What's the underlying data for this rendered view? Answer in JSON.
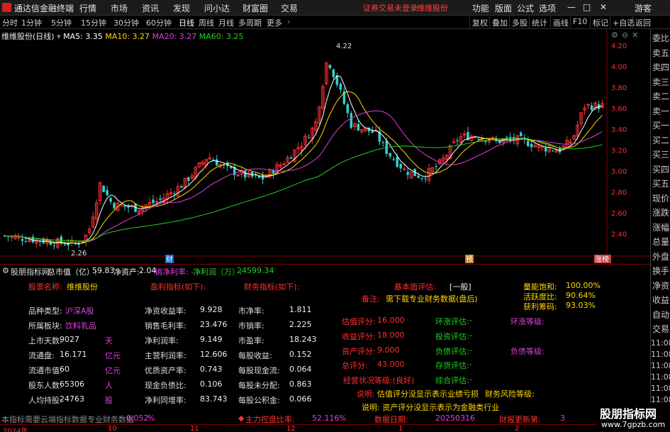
{
  "menubar": {
    "title": "通达信金融终端",
    "items": [
      "行情",
      "市场",
      "资讯",
      "发现",
      "问小达",
      "财富圈",
      "交易"
    ],
    "notice": "证券交易未登录",
    "notice2": "维维股份",
    "right_items": [
      "功能",
      "版面",
      "公式",
      "选项"
    ],
    "minimize": "—",
    "maximize": "□",
    "close": "✕",
    "guest": "游客"
  },
  "toolbar": {
    "periods": [
      "分时",
      "1分钟",
      "5分钟",
      "15分钟",
      "30分钟",
      "60分钟",
      "日线",
      "周线",
      "月线",
      "多周期",
      "更多"
    ],
    "active": "日线",
    "right_tools": [
      "复权",
      "叠加",
      "多股",
      "统计",
      "画线",
      "F10",
      "标记",
      "+自选",
      "返回"
    ]
  },
  "legend": {
    "name": "维维股份(日线)",
    "ma5": "MA5: 3.35",
    "ma10": "MA10: 3.27",
    "ma20": "MA20: 3.27",
    "ma60": "MA60: 3.25"
  },
  "colors": {
    "ma5": "#ffffff",
    "ma10": "#ffd700",
    "ma20": "#e040e0",
    "ma60": "#20d020",
    "up": "#ff3030",
    "down": "#30d0d0"
  },
  "price_axis": {
    "ticks": [
      "4.20",
      "4.00",
      "3.80",
      "3.60",
      "3.40",
      "3.20",
      "3.00",
      "2.80",
      "2.60",
      "2.40"
    ],
    "high_label": "4.22",
    "low_label": "2.26"
  },
  "chart_data": {
    "type": "candlestick",
    "x_labels": [
      "2024年",
      "10",
      "11",
      "12",
      "1",
      "2"
    ],
    "markers": [
      "财",
      "预",
      "涨榜"
    ],
    "ylim": [
      2.2,
      4.3
    ]
  },
  "right_panel": {
    "labels": [
      "委比",
      "卖五",
      "卖四",
      "卖三",
      "卖二",
      "卖一",
      "买一",
      "买二",
      "买三",
      "买四",
      "买五",
      "现价",
      "涨跌",
      "涨幅",
      "总量",
      "外盘",
      "换手",
      "净资",
      "收益",
      "自动",
      "交易"
    ],
    "times": [
      "11:08",
      "11:08",
      "11:08",
      "11:08",
      "11:08",
      "11:08",
      "11:08",
      "11:08"
    ]
  },
  "header_line": {
    "title": "股朋指标网",
    "total_label": "总市值（亿）:",
    "total_value": "59.83",
    "net_label": "净资产:",
    "net_value": "2.04",
    "sales_label": "销净利率: -",
    "profit_label": "净利润（万）:",
    "profit_value": "24599.34"
  },
  "col1": {
    "title_label": "股票名称:",
    "title_value": "维维股份",
    "rows": [
      {
        "label": "品种类型:",
        "value": "沪深A股"
      },
      {
        "label": "所属板块:",
        "value": "饮料乳品"
      },
      {
        "label": "上市天数:",
        "value": "9027",
        "unit": "天"
      },
      {
        "label": "流通盘:",
        "value": "16.171",
        "unit": "亿元"
      },
      {
        "label": "流通市值:",
        "value": "60",
        "unit": "亿元"
      },
      {
        "label": "股东人数:",
        "value": "65306",
        "unit": "人"
      },
      {
        "label": "人均持股:",
        "value": "24763",
        "unit": "股"
      }
    ]
  },
  "col2": {
    "title": "盈利指标(如下):",
    "rows": [
      {
        "label": "净资收益率:",
        "value": "9.928"
      },
      {
        "label": "销售毛利率:",
        "value": "23.476"
      },
      {
        "label": "净利润率:",
        "value": "9.149"
      },
      {
        "label": "主营利润率:",
        "value": "12.606"
      },
      {
        "label": "优质资产率:",
        "value": "0.743"
      },
      {
        "label": "现金负债比:",
        "value": "0.106"
      },
      {
        "label": "净利同增率:",
        "value": "83.743"
      }
    ]
  },
  "col3": {
    "title": "财务指标(如下):",
    "rows": [
      {
        "label": "市净率:",
        "value": "1.811"
      },
      {
        "label": "市销率:",
        "value": "2.225"
      },
      {
        "label": "市盈率:",
        "value": "18.243"
      },
      {
        "label": "每股收益:",
        "value": "0.152"
      },
      {
        "label": "每股现金流:",
        "value": "0.064"
      },
      {
        "label": "每股未分配:",
        "value": "0.863"
      },
      {
        "label": "每股公积金:",
        "value": "0.066"
      }
    ]
  },
  "col4": {
    "basic_label": "基本面评估:",
    "basic_value": "[一般]",
    "note_label": "备注:",
    "note_value": "需下载专业财务数据(盘后)",
    "rows": [
      {
        "label": "估值评分:",
        "value": "16.000"
      },
      {
        "label": "收益评分:",
        "value": "18.000"
      },
      {
        "label": "资产评分:",
        "value": "9.000"
      },
      {
        "label": "总评分:",
        "value": "43.000"
      }
    ],
    "status": "经营状况等级:(良好)",
    "explain1_label": "说明:",
    "explain1_value": "估值评分没显示表示业绩亏损",
    "risk_label": "财务风险等级:",
    "explain2": "说明: 资产评分没显示表示为金融类行业"
  },
  "col5": {
    "rows": [
      {
        "label": "环涨评估:",
        "value": "-"
      },
      {
        "label": "投资评估:",
        "value": "-"
      },
      {
        "label": "负债评估:",
        "value": "-"
      },
      {
        "label": "存货评估:",
        "value": "-"
      },
      {
        "label": "综合评估:",
        "value": "-"
      }
    ],
    "ring_label": "环涨等级:",
    "debt_label": "负债等级:"
  },
  "col6": {
    "rows": [
      {
        "label": "量能饱和:",
        "value": "100.00%"
      },
      {
        "label": "活跃度比:",
        "value": "90.64%"
      },
      {
        "label": "获利筹码:",
        "value": "93.03%"
      }
    ]
  },
  "footer": {
    "left_text": "本指标需要云端指标数据专业财务数据",
    "left_value": "0.052",
    "left_unit": "%",
    "center_label": "主力控盘比率:",
    "center_value": "52.116",
    "center_unit": "%",
    "date_label": "数据日期:",
    "date_value": "20250316",
    "update_label": "财报更新第:",
    "update_value": "3"
  },
  "watermark": {
    "text": "股朋指标网",
    "url": "www.7gpzb.com"
  }
}
